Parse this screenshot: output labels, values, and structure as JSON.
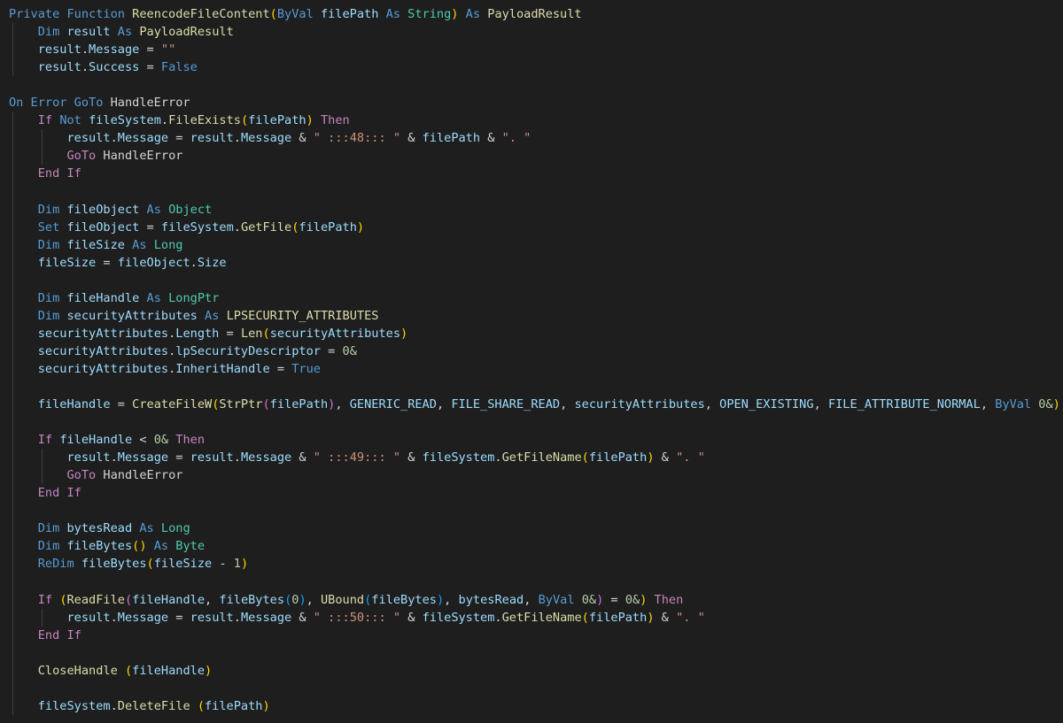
{
  "colors": {
    "keyword": "#569cd6",
    "control": "#c586c0",
    "function": "#dcdcaa",
    "type": "#4ec9b0",
    "type_alt": "#dcdcaa",
    "variable": "#9cdcfe",
    "string": "#ce9178",
    "number": "#b5cea8",
    "punct": "#d4d4d4",
    "paren1": "#ffd700",
    "paren2": "#da70d6",
    "paren3": "#179fff",
    "guide": "#404040"
  },
  "editor": {
    "lines": [
      {
        "indent": 0,
        "tokens": [
          [
            "Private Function ",
            "keyword"
          ],
          [
            "ReencodeFileContent",
            "function"
          ],
          [
            "(",
            "paren1"
          ],
          [
            "ByVal ",
            "keyword"
          ],
          [
            "filePath",
            "variable"
          ],
          [
            " As ",
            "keyword"
          ],
          [
            "String",
            "type"
          ],
          [
            "(",
            "hidden"
          ],
          [
            ")",
            "paren1"
          ],
          [
            " As ",
            "keyword"
          ],
          [
            "PayloadResult",
            "type_alt"
          ]
        ]
      },
      {
        "indent": 1,
        "tokens": [
          [
            "Dim ",
            "keyword"
          ],
          [
            "result",
            "variable"
          ],
          [
            " As ",
            "keyword"
          ],
          [
            "PayloadResult",
            "type_alt"
          ]
        ]
      },
      {
        "indent": 1,
        "tokens": [
          [
            "result",
            "variable"
          ],
          [
            ".",
            "punct"
          ],
          [
            "Message",
            "variable"
          ],
          [
            " = ",
            "punct"
          ],
          [
            "\"\"",
            "string"
          ]
        ]
      },
      {
        "indent": 1,
        "tokens": [
          [
            "result",
            "variable"
          ],
          [
            ".",
            "punct"
          ],
          [
            "Success",
            "variable"
          ],
          [
            " = ",
            "punct"
          ],
          [
            "False",
            "keyword"
          ]
        ]
      },
      {
        "indent": 0,
        "tokens": []
      },
      {
        "indent": 0,
        "tokens": [
          [
            "On Error GoTo ",
            "keyword"
          ],
          [
            "HandleError",
            "punct"
          ]
        ]
      },
      {
        "indent": 1,
        "tokens": [
          [
            "If ",
            "control"
          ],
          [
            "Not ",
            "keyword"
          ],
          [
            "fileSystem",
            "variable"
          ],
          [
            ".",
            "punct"
          ],
          [
            "FileExists",
            "function"
          ],
          [
            "(",
            "paren1"
          ],
          [
            "filePath",
            "variable"
          ],
          [
            ")",
            "paren1"
          ],
          [
            " Then",
            "control"
          ]
        ]
      },
      {
        "indent": 2,
        "tokens": [
          [
            "result",
            "variable"
          ],
          [
            ".",
            "punct"
          ],
          [
            "Message",
            "variable"
          ],
          [
            " = ",
            "punct"
          ],
          [
            "result",
            "variable"
          ],
          [
            ".",
            "punct"
          ],
          [
            "Message",
            "variable"
          ],
          [
            " & ",
            "punct"
          ],
          [
            "\" :::48::: \"",
            "string"
          ],
          [
            " & ",
            "punct"
          ],
          [
            "filePath",
            "variable"
          ],
          [
            " & ",
            "punct"
          ],
          [
            "\". \"",
            "string"
          ]
        ]
      },
      {
        "indent": 2,
        "tokens": [
          [
            "GoTo ",
            "control"
          ],
          [
            "HandleError",
            "punct"
          ]
        ]
      },
      {
        "indent": 1,
        "tokens": [
          [
            "End If",
            "control"
          ]
        ]
      },
      {
        "indent": 1,
        "tokens": []
      },
      {
        "indent": 1,
        "tokens": [
          [
            "Dim ",
            "keyword"
          ],
          [
            "fileObject",
            "variable"
          ],
          [
            " As ",
            "keyword"
          ],
          [
            "Object",
            "type"
          ]
        ]
      },
      {
        "indent": 1,
        "tokens": [
          [
            "Set ",
            "keyword"
          ],
          [
            "fileObject",
            "variable"
          ],
          [
            " = ",
            "punct"
          ],
          [
            "fileSystem",
            "variable"
          ],
          [
            ".",
            "punct"
          ],
          [
            "GetFile",
            "function"
          ],
          [
            "(",
            "paren1"
          ],
          [
            "filePath",
            "variable"
          ],
          [
            ")",
            "paren1"
          ]
        ]
      },
      {
        "indent": 1,
        "tokens": [
          [
            "Dim ",
            "keyword"
          ],
          [
            "fileSize",
            "variable"
          ],
          [
            " As ",
            "keyword"
          ],
          [
            "Long",
            "type"
          ]
        ]
      },
      {
        "indent": 1,
        "tokens": [
          [
            "fileSize",
            "variable"
          ],
          [
            " = ",
            "punct"
          ],
          [
            "fileObject",
            "variable"
          ],
          [
            ".",
            "punct"
          ],
          [
            "Size",
            "variable"
          ]
        ]
      },
      {
        "indent": 1,
        "tokens": []
      },
      {
        "indent": 1,
        "tokens": [
          [
            "Dim ",
            "keyword"
          ],
          [
            "fileHandle",
            "variable"
          ],
          [
            " As ",
            "keyword"
          ],
          [
            "LongPtr",
            "type"
          ]
        ]
      },
      {
        "indent": 1,
        "tokens": [
          [
            "Dim ",
            "keyword"
          ],
          [
            "securityAttributes",
            "variable"
          ],
          [
            " As ",
            "keyword"
          ],
          [
            "LPSECURITY_ATTRIBUTES",
            "type_alt"
          ]
        ]
      },
      {
        "indent": 1,
        "tokens": [
          [
            "securityAttributes",
            "variable"
          ],
          [
            ".",
            "punct"
          ],
          [
            "Length",
            "variable"
          ],
          [
            " = ",
            "punct"
          ],
          [
            "Len",
            "function"
          ],
          [
            "(",
            "paren1"
          ],
          [
            "securityAttributes",
            "variable"
          ],
          [
            ")",
            "paren1"
          ]
        ]
      },
      {
        "indent": 1,
        "tokens": [
          [
            "securityAttributes",
            "variable"
          ],
          [
            ".",
            "punct"
          ],
          [
            "lpSecurityDescriptor",
            "variable"
          ],
          [
            " = ",
            "punct"
          ],
          [
            "0&",
            "number"
          ]
        ]
      },
      {
        "indent": 1,
        "tokens": [
          [
            "securityAttributes",
            "variable"
          ],
          [
            ".",
            "punct"
          ],
          [
            "InheritHandle",
            "variable"
          ],
          [
            " = ",
            "punct"
          ],
          [
            "True",
            "keyword"
          ]
        ]
      },
      {
        "indent": 1,
        "tokens": []
      },
      {
        "indent": 1,
        "tokens": [
          [
            "fileHandle",
            "variable"
          ],
          [
            " = ",
            "punct"
          ],
          [
            "CreateFileW",
            "function"
          ],
          [
            "(",
            "paren1"
          ],
          [
            "StrPtr",
            "function"
          ],
          [
            "(",
            "paren2"
          ],
          [
            "filePath",
            "variable"
          ],
          [
            ")",
            "paren2"
          ],
          [
            ", ",
            "punct"
          ],
          [
            "GENERIC_READ",
            "variable"
          ],
          [
            ", ",
            "punct"
          ],
          [
            "FILE_SHARE_READ",
            "variable"
          ],
          [
            ", ",
            "punct"
          ],
          [
            "securityAttributes",
            "variable"
          ],
          [
            ", ",
            "punct"
          ],
          [
            "OPEN_EXISTING",
            "variable"
          ],
          [
            ", ",
            "punct"
          ],
          [
            "FILE_ATTRIBUTE_NORMAL",
            "variable"
          ],
          [
            ", ",
            "punct"
          ],
          [
            "ByVal ",
            "keyword"
          ],
          [
            "0&",
            "number"
          ],
          [
            ")",
            "paren1"
          ]
        ]
      },
      {
        "indent": 1,
        "tokens": []
      },
      {
        "indent": 1,
        "tokens": [
          [
            "If ",
            "control"
          ],
          [
            "fileHandle",
            "variable"
          ],
          [
            " < ",
            "punct"
          ],
          [
            "0&",
            "number"
          ],
          [
            " Then",
            "control"
          ]
        ]
      },
      {
        "indent": 2,
        "tokens": [
          [
            "result",
            "variable"
          ],
          [
            ".",
            "punct"
          ],
          [
            "Message",
            "variable"
          ],
          [
            " = ",
            "punct"
          ],
          [
            "result",
            "variable"
          ],
          [
            ".",
            "punct"
          ],
          [
            "Message",
            "variable"
          ],
          [
            " & ",
            "punct"
          ],
          [
            "\" :::49::: \"",
            "string"
          ],
          [
            " & ",
            "punct"
          ],
          [
            "fileSystem",
            "variable"
          ],
          [
            ".",
            "punct"
          ],
          [
            "GetFileName",
            "function"
          ],
          [
            "(",
            "paren1"
          ],
          [
            "filePath",
            "variable"
          ],
          [
            ")",
            "paren1"
          ],
          [
            " & ",
            "punct"
          ],
          [
            "\". \"",
            "string"
          ]
        ]
      },
      {
        "indent": 2,
        "tokens": [
          [
            "GoTo ",
            "control"
          ],
          [
            "HandleError",
            "punct"
          ]
        ]
      },
      {
        "indent": 1,
        "tokens": [
          [
            "End If",
            "control"
          ]
        ]
      },
      {
        "indent": 1,
        "tokens": []
      },
      {
        "indent": 1,
        "tokens": [
          [
            "Dim ",
            "keyword"
          ],
          [
            "bytesRead",
            "variable"
          ],
          [
            " As ",
            "keyword"
          ],
          [
            "Long",
            "type"
          ]
        ]
      },
      {
        "indent": 1,
        "tokens": [
          [
            "Dim ",
            "keyword"
          ],
          [
            "fileBytes",
            "variable"
          ],
          [
            "()",
            "paren1"
          ],
          [
            " As ",
            "keyword"
          ],
          [
            "Byte",
            "type"
          ]
        ]
      },
      {
        "indent": 1,
        "tokens": [
          [
            "ReDim ",
            "keyword"
          ],
          [
            "fileBytes",
            "variable"
          ],
          [
            "(",
            "paren1"
          ],
          [
            "fileSize",
            "variable"
          ],
          [
            " - ",
            "punct"
          ],
          [
            "1",
            "number"
          ],
          [
            ")",
            "paren1"
          ]
        ]
      },
      {
        "indent": 1,
        "tokens": []
      },
      {
        "indent": 1,
        "tokens": [
          [
            "If ",
            "control"
          ],
          [
            "(",
            "paren1"
          ],
          [
            "ReadFile",
            "function"
          ],
          [
            "(",
            "paren2"
          ],
          [
            "fileHandle",
            "variable"
          ],
          [
            ", ",
            "punct"
          ],
          [
            "fileBytes",
            "variable"
          ],
          [
            "(",
            "paren3"
          ],
          [
            "0",
            "number"
          ],
          [
            ")",
            "paren3"
          ],
          [
            ", ",
            "punct"
          ],
          [
            "UBound",
            "function"
          ],
          [
            "(",
            "paren3"
          ],
          [
            "fileBytes",
            "variable"
          ],
          [
            ")",
            "paren3"
          ],
          [
            ", ",
            "punct"
          ],
          [
            "bytesRead",
            "variable"
          ],
          [
            ", ",
            "punct"
          ],
          [
            "ByVal ",
            "keyword"
          ],
          [
            "0&",
            "number"
          ],
          [
            ")",
            "paren2"
          ],
          [
            " = ",
            "punct"
          ],
          [
            "0&",
            "number"
          ],
          [
            ")",
            "paren1"
          ],
          [
            " Then",
            "control"
          ]
        ]
      },
      {
        "indent": 2,
        "tokens": [
          [
            "result",
            "variable"
          ],
          [
            ".",
            "punct"
          ],
          [
            "Message",
            "variable"
          ],
          [
            " = ",
            "punct"
          ],
          [
            "result",
            "variable"
          ],
          [
            ".",
            "punct"
          ],
          [
            "Message",
            "variable"
          ],
          [
            " & ",
            "punct"
          ],
          [
            "\" :::50::: \"",
            "string"
          ],
          [
            " & ",
            "punct"
          ],
          [
            "fileSystem",
            "variable"
          ],
          [
            ".",
            "punct"
          ],
          [
            "GetFileName",
            "function"
          ],
          [
            "(",
            "paren1"
          ],
          [
            "filePath",
            "variable"
          ],
          [
            ")",
            "paren1"
          ],
          [
            " & ",
            "punct"
          ],
          [
            "\". \"",
            "string"
          ]
        ]
      },
      {
        "indent": 1,
        "tokens": [
          [
            "End If",
            "control"
          ]
        ]
      },
      {
        "indent": 1,
        "tokens": []
      },
      {
        "indent": 1,
        "tokens": [
          [
            "CloseHandle",
            "function"
          ],
          [
            " ",
            "punct"
          ],
          [
            "(",
            "paren1"
          ],
          [
            "fileHandle",
            "variable"
          ],
          [
            ")",
            "paren1"
          ]
        ]
      },
      {
        "indent": 1,
        "tokens": []
      },
      {
        "indent": 1,
        "tokens": [
          [
            "fileSystem",
            "variable"
          ],
          [
            ".",
            "punct"
          ],
          [
            "DeleteFile",
            "function"
          ],
          [
            " ",
            "punct"
          ],
          [
            "(",
            "paren1"
          ],
          [
            "filePath",
            "variable"
          ],
          [
            ")",
            "paren1"
          ]
        ]
      }
    ]
  }
}
